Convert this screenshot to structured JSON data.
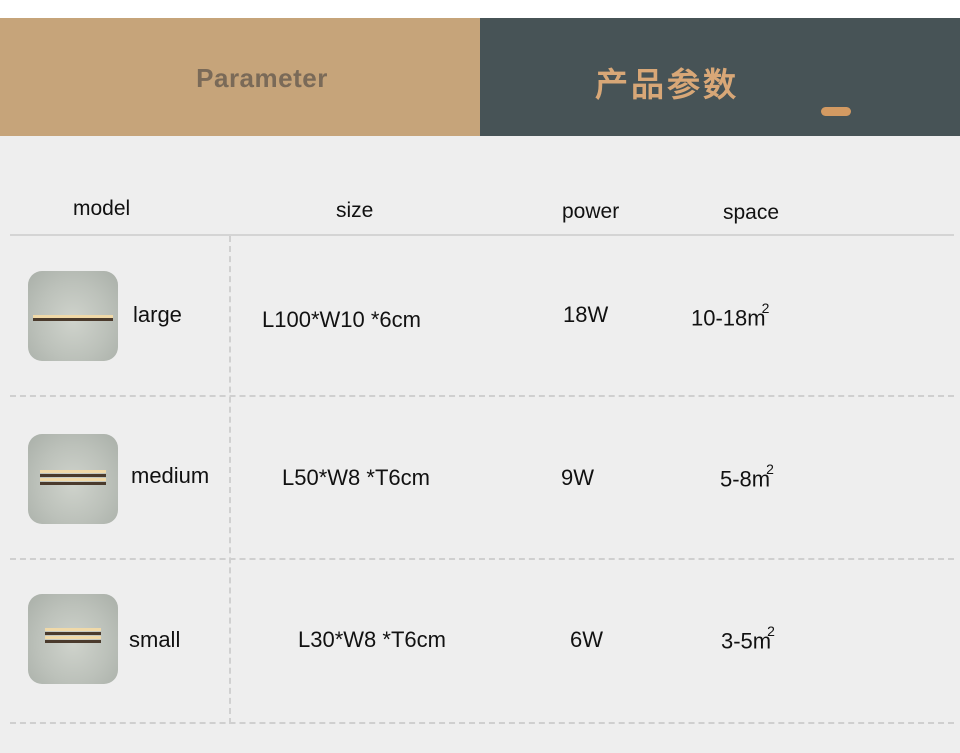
{
  "banner": {
    "left_title": "Parameter",
    "right_title": "产品参数"
  },
  "table": {
    "headers": {
      "model": "model",
      "size": "size",
      "power": "power",
      "space": "space"
    },
    "rows": [
      {
        "model": "large",
        "size": "L100*W10 *6cm",
        "power": "18W",
        "space": "10-18m",
        "space_unit_exp": "2"
      },
      {
        "model": "medium",
        "size": "L50*W8 *T6cm",
        "power": "9W",
        "space": "5-8m",
        "space_unit_exp": "2"
      },
      {
        "model": "small",
        "size": "L30*W8 *T6cm",
        "power": "6W",
        "space": "3-5m",
        "space_unit_exp": "2"
      }
    ]
  },
  "colors": {
    "banner_left": "#c6a47a",
    "banner_right": "#475356",
    "accent": "#d39a62",
    "panel": "#eeeeee"
  }
}
